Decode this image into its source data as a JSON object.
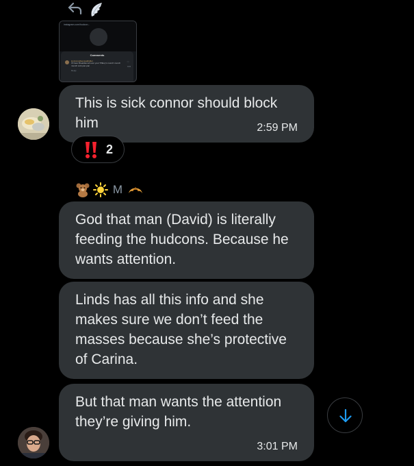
{
  "header": {
    "reply_icon": "reply-arrow-icon",
    "decoration_icon": "angel-wing-icon"
  },
  "quoted_image": {
    "url_text": "instagram.com/hudcon...",
    "sheet_title": "Comments",
    "commenter": "lexiconnellsensualfolder",
    "comment_text": "I'll have Breakfast all over your Tiffany's munch munch munch cork pan pan",
    "reply_label": "Reply",
    "like_count": "193"
  },
  "colors": {
    "background": "#000000",
    "bubble": "#2f3336",
    "text": "#e7e9ea",
    "muted": "#8b98a5",
    "accent": "#1d9bf0",
    "reaction_red": "#f4212e"
  },
  "messages": [
    {
      "text": "This is sick connor should block him",
      "time": "2:59 PM",
      "reaction": {
        "emoji": "double-exclamation-mark",
        "count": "2"
      }
    },
    {
      "sender": {
        "prefix_emoji": "teddy-bear",
        "sun_emoji": "sun",
        "name": "M",
        "suffix_emoji": "croissant"
      },
      "text": "God that man (David) is literally feeding the hudcons. Because he wants attention."
    },
    {
      "text": "Linds has all this info and she makes sure we don’t feed the masses because she’s protective of Carina."
    },
    {
      "text": "But that man wants the attention they’re giving him.",
      "time": "3:01 PM"
    }
  ],
  "scroll_button": {
    "icon": "arrow-down-icon"
  }
}
